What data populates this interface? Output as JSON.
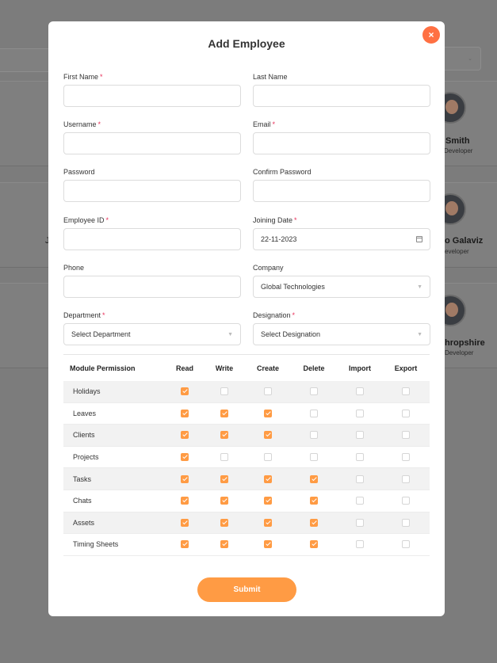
{
  "background": {
    "people": [
      {
        "name": "Smith",
        "role": "Developer"
      },
      {
        "name": "o Galaviz",
        "role": "eveloper"
      },
      {
        "name": "hropshire",
        "role": "Developer"
      }
    ],
    "stray_letter": "J"
  },
  "modal": {
    "title": "Add Employee",
    "close_glyph": "×",
    "fields": {
      "first_name": {
        "label": "First Name",
        "required": true,
        "value": ""
      },
      "last_name": {
        "label": "Last Name",
        "required": false,
        "value": ""
      },
      "username": {
        "label": "Username",
        "required": true,
        "value": ""
      },
      "email": {
        "label": "Email",
        "required": true,
        "value": ""
      },
      "password": {
        "label": "Password",
        "required": false,
        "value": ""
      },
      "confirm_password": {
        "label": "Confirm Password",
        "required": false,
        "value": ""
      },
      "employee_id": {
        "label": "Employee ID",
        "required": true,
        "value": ""
      },
      "joining_date": {
        "label": "Joining Date",
        "required": true,
        "value": "22-11-2023"
      },
      "phone": {
        "label": "Phone",
        "required": false,
        "value": ""
      },
      "company": {
        "label": "Company",
        "required": false,
        "value": "Global Technologies"
      },
      "department": {
        "label": "Department",
        "required": true,
        "value": "Select Department"
      },
      "designation": {
        "label": "Designation",
        "required": true,
        "value": "Select Designation"
      }
    },
    "required_mark": "*",
    "permissions": {
      "headers": [
        "Module Permission",
        "Read",
        "Write",
        "Create",
        "Delete",
        "Import",
        "Export"
      ],
      "rows": [
        {
          "module": "Holidays",
          "checks": [
            true,
            false,
            false,
            false,
            false,
            false
          ]
        },
        {
          "module": "Leaves",
          "checks": [
            true,
            true,
            true,
            false,
            false,
            false
          ]
        },
        {
          "module": "Clients",
          "checks": [
            true,
            true,
            true,
            false,
            false,
            false
          ]
        },
        {
          "module": "Projects",
          "checks": [
            true,
            false,
            false,
            false,
            false,
            false
          ]
        },
        {
          "module": "Tasks",
          "checks": [
            true,
            true,
            true,
            true,
            false,
            false
          ]
        },
        {
          "module": "Chats",
          "checks": [
            true,
            true,
            true,
            true,
            false,
            false
          ]
        },
        {
          "module": "Assets",
          "checks": [
            true,
            true,
            true,
            true,
            false,
            false
          ]
        },
        {
          "module": "Timing Sheets",
          "checks": [
            true,
            true,
            true,
            true,
            false,
            false
          ]
        }
      ]
    },
    "submit_label": "Submit",
    "colors": {
      "accent": "#ff9b44",
      "close": "#ff7043",
      "required": "#e8315b"
    }
  }
}
